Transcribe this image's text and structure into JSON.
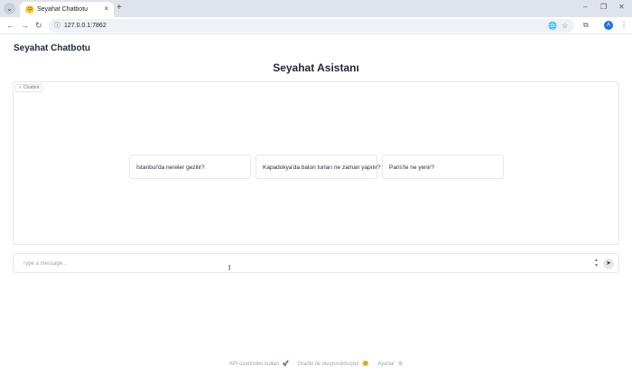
{
  "browser": {
    "tab_title": "Seyahat Chatbotu",
    "tab_favicon": "🤗",
    "tab_list_icon": "chevron-down-icon",
    "close_glyph": "×",
    "new_tab_glyph": "+",
    "minimize_glyph": "–",
    "restore_glyph": "❐",
    "window_close_glyph": "✕",
    "back_glyph": "←",
    "forward_glyph": "→",
    "reload_glyph": "↻",
    "site_info_glyph": "ⓘ",
    "url": "127.0.0.1:7862",
    "translate_glyph": "🌐",
    "bookmark_glyph": "☆",
    "extensions_glyph": "⧉",
    "profile_initial": "A",
    "menu_glyph": "⋮"
  },
  "app": {
    "title": "Seyahat Chatbotu",
    "heading": "Seyahat Asistanı"
  },
  "chatbot": {
    "label": "Chatbot",
    "label_glyph": "≡",
    "examples": [
      "İstanbul'da nereler gezilir?",
      "Kapadokya'da balon turları ne zaman yapılır?",
      "Paris'te ne yenir?"
    ]
  },
  "input": {
    "placeholder": "Type a message...",
    "stepper_up": "▲",
    "stepper_down": "▼",
    "send_glyph": "➤"
  },
  "cursor_glyph": "I",
  "footer": {
    "api": "API üzerinden kullan",
    "api_icon": "🚀",
    "sep1": "·",
    "built": "Gradio ile oluşturulmuştur",
    "built_icon": "🤗",
    "sep2": "·",
    "settings": "Ayarlar",
    "settings_icon": "⚙"
  },
  "colors": {
    "chrome_bg": "#dfe3eb",
    "accent": "#1a73e8",
    "border": "#e5e7eb"
  }
}
